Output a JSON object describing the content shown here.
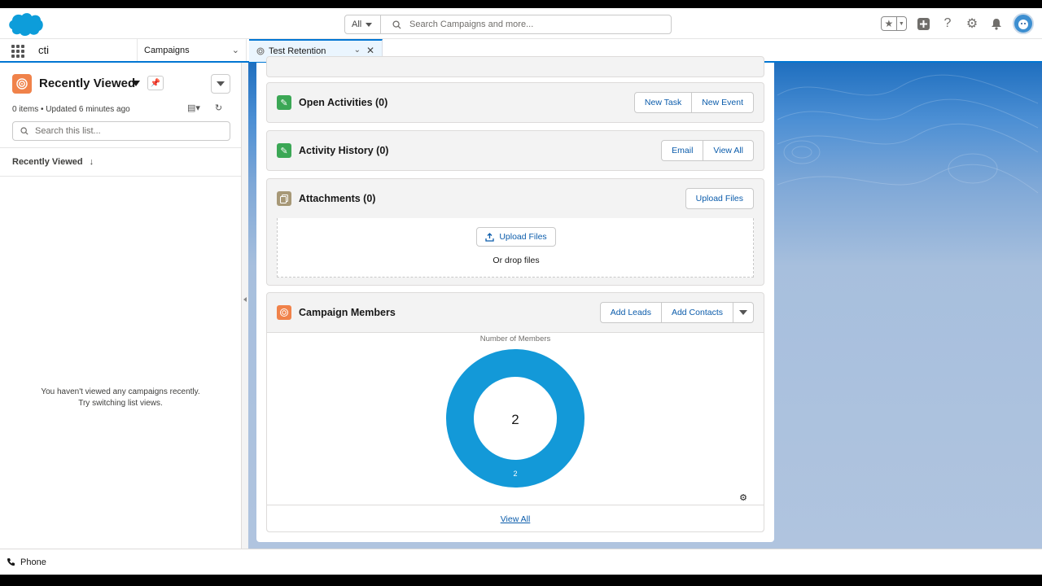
{
  "header": {
    "search_scope": "All",
    "search_placeholder": "Search Campaigns and more..."
  },
  "nav": {
    "app_name": "cti",
    "object_tab": "Campaigns",
    "workspace_tab": "Test Retention"
  },
  "list_view": {
    "title": "Recently Viewed",
    "meta": "0 items • Updated 6 minutes ago",
    "search_placeholder": "Search this list...",
    "column_header": "Recently Viewed",
    "empty_line1": "You haven't viewed any campaigns recently.",
    "empty_line2": "Try switching list views."
  },
  "related": {
    "open_activities": {
      "title": "Open Activities (0)",
      "buttons": [
        "New Task",
        "New Event"
      ],
      "icon_color": "#3ba755"
    },
    "activity_history": {
      "title": "Activity History (0)",
      "buttons": [
        "Email",
        "View All"
      ],
      "icon_color": "#3ba755"
    },
    "attachments": {
      "title": "Attachments (0)",
      "button": "Upload Files",
      "upload_label": "Upload Files",
      "drop_label": "Or drop files",
      "icon_color": "#a79877"
    },
    "campaign_members": {
      "title": "Campaign Members",
      "buttons": [
        "Add Leads",
        "Add Contacts"
      ],
      "view_all": "View All",
      "icon_color": "#f0824a"
    }
  },
  "chart_data": {
    "type": "pie",
    "title": "Number of Members",
    "center_label": "2",
    "slices": [
      {
        "value": 2,
        "label": "2",
        "color": "#1399d8"
      }
    ]
  },
  "footer": {
    "utility_item": "Phone"
  },
  "colors": {
    "brand": "#0176d3",
    "link": "#0b5cab"
  }
}
